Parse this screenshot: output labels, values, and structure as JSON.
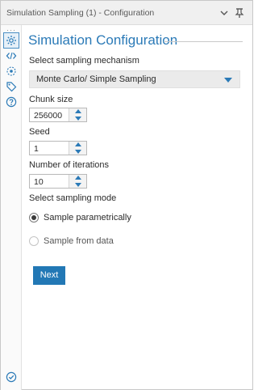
{
  "window": {
    "title": "Simulation Sampling (1) - Configuration"
  },
  "rail": {
    "icons": [
      "gear-icon",
      "code-icon",
      "target-icon",
      "tag-icon",
      "help-icon"
    ],
    "bottom_icon": "check-circle-icon"
  },
  "main": {
    "heading": "Simulation Configuration",
    "mechanism": {
      "label": "Select sampling mechanism",
      "selected": "Monte Carlo/ Simple Sampling"
    },
    "chunk_size": {
      "label": "Chunk size",
      "value": "256000"
    },
    "seed": {
      "label": "Seed",
      "value": "1"
    },
    "iterations": {
      "label": "Number of iterations",
      "value": "10"
    },
    "mode": {
      "label": "Select sampling mode",
      "options": [
        {
          "label": "Sample parametrically",
          "selected": true
        },
        {
          "label": "Sample from data",
          "selected": false
        }
      ]
    },
    "next_label": "Next"
  },
  "colors": {
    "accent": "#2b7ab7",
    "button": "#2278b5"
  }
}
